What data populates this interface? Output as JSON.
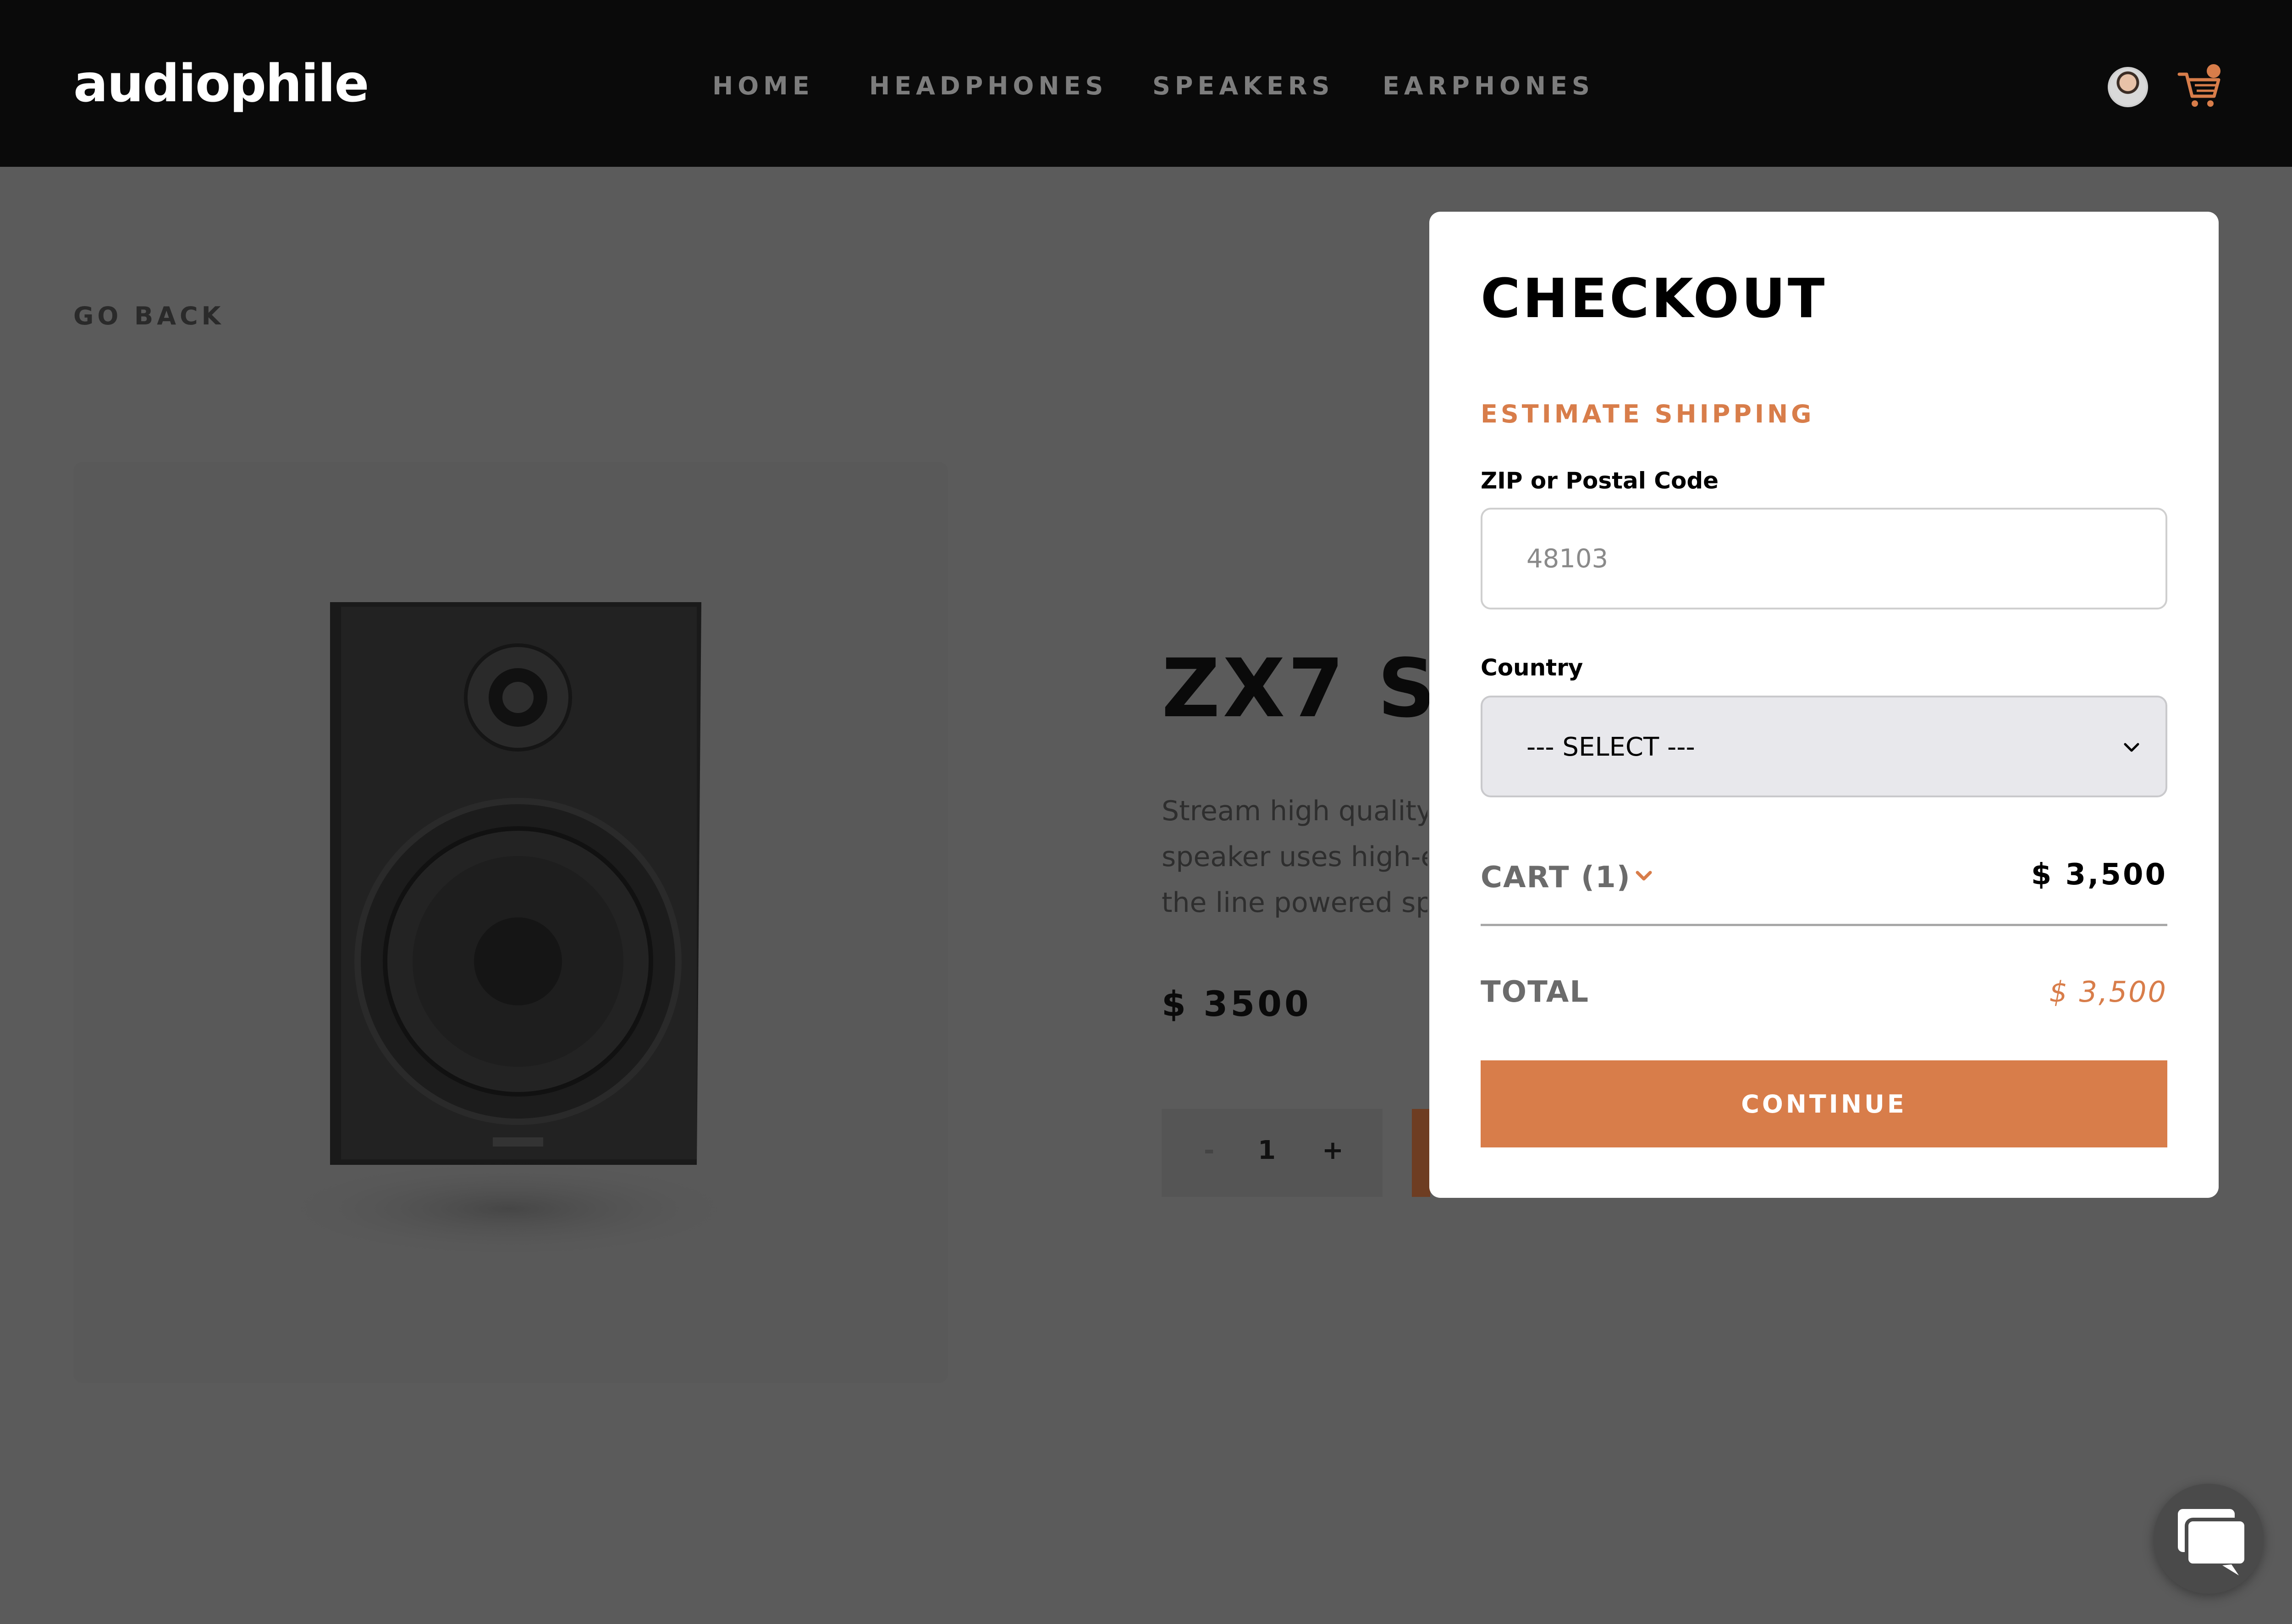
{
  "header": {
    "logo": "audiophile",
    "nav": [
      "HOME",
      "HEADPHONES",
      "SPEAKERS",
      "EARPHONES"
    ]
  },
  "product": {
    "go_back": "GO BACK",
    "title_visible": "ZX7 S",
    "description_lines": [
      "Stream high quality",
      "speaker uses high-e",
      "the line powered sp"
    ],
    "price": "$ 3500",
    "quantity": "1",
    "minus": "-",
    "plus": "+"
  },
  "checkout": {
    "title": "CHECKOUT",
    "subtitle": "ESTIMATE SHIPPING",
    "zip_label": "ZIP or Postal Code",
    "zip_placeholder": "48103",
    "country_label": "Country",
    "country_selected": "--- SELECT ---",
    "cart_label": "CART (1)",
    "cart_amount": "$ 3,500",
    "total_label": "TOTAL",
    "total_amount": "$ 3,500",
    "continue_label": "CONTINUE"
  },
  "colors": {
    "accent": "#d87d4a",
    "header_bg": "#0a0a0a",
    "overlay_bg": "#5b5b5b"
  },
  "icons": [
    "avatar",
    "cart-icon",
    "chevron-down-icon",
    "chat-icon"
  ]
}
